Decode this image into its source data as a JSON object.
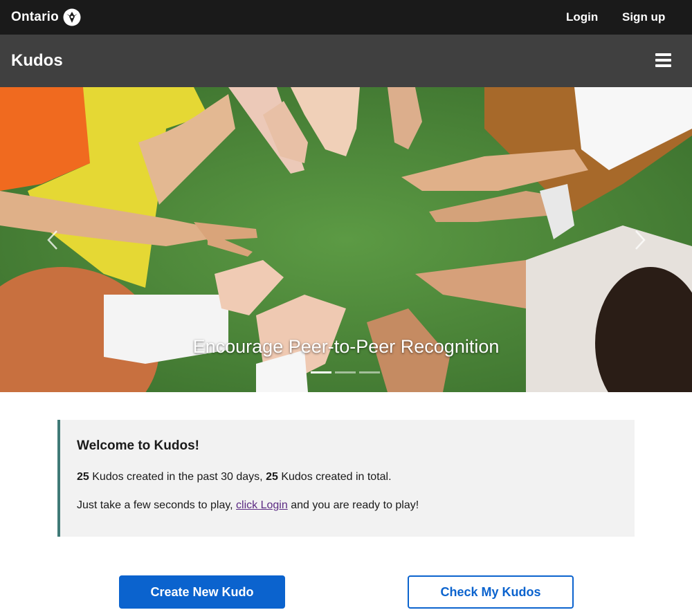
{
  "topbar": {
    "brand": "Ontario",
    "login": "Login",
    "signup": "Sign up"
  },
  "appbar": {
    "title": "Kudos",
    "menu_icon": "hamburger-menu-icon"
  },
  "hero": {
    "caption": "Encourage Peer-to-Peer Recognition",
    "slides_count": 3,
    "active_slide": 1,
    "prev_icon": "chevron-left-icon",
    "next_icon": "chevron-right-icon"
  },
  "welcome": {
    "heading": "Welcome to Kudos!",
    "count_recent": "25",
    "text_recent": " Kudos created in the past 30 days, ",
    "count_total": "25",
    "text_total": " Kudos created in total.",
    "play_prefix": "Just take a few seconds to play, ",
    "play_link": "click Login",
    "play_suffix": " and you are ready to play!"
  },
  "actions": {
    "create": "Create New Kudo",
    "check": "Check My Kudos"
  },
  "colors": {
    "topbar_bg": "#1a1a1a",
    "appbar_bg": "#404040",
    "panel_bg": "#f2f2f2",
    "panel_accent": "#3f7a77",
    "primary": "#0b63ce",
    "link": "#5b2a82"
  }
}
